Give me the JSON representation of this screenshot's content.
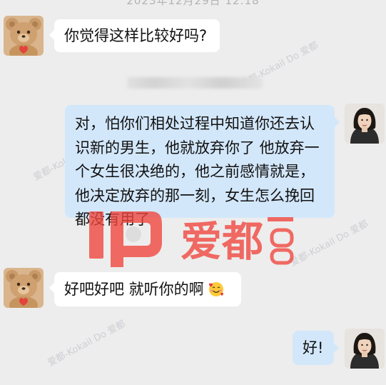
{
  "header": {
    "timestamp": "2023年12月29日 12:18"
  },
  "messages": [
    {
      "sender": "contact",
      "avatar": "teddy-bear-avatar",
      "text": "你觉得这样比较好吗?"
    },
    {
      "sender": "self",
      "avatar": "woman-avatar",
      "text": "对，怕你们相处过程中知道你还去认识新的男生，他就放弃你了 他放弃一个女生很决绝的，他之前感情就是，他决定放弃的那一刻，女生怎么挽回都没有用了"
    },
    {
      "sender": "contact",
      "avatar": "teddy-bear-avatar",
      "text": "好吧好吧 就听你的啊",
      "emoji": "smiling-face-with-hearts-icon"
    },
    {
      "sender": "self",
      "avatar": "woman-avatar",
      "text": "好!"
    }
  ],
  "watermark": {
    "logo_text": "爱都",
    "tag_text": "爱都-Kokail Do 爱都"
  },
  "colors": {
    "background": "#ededed",
    "bubble_self": "#d3e7fa",
    "bubble_contact": "#ffffff",
    "watermark_red": "#f0453c"
  }
}
